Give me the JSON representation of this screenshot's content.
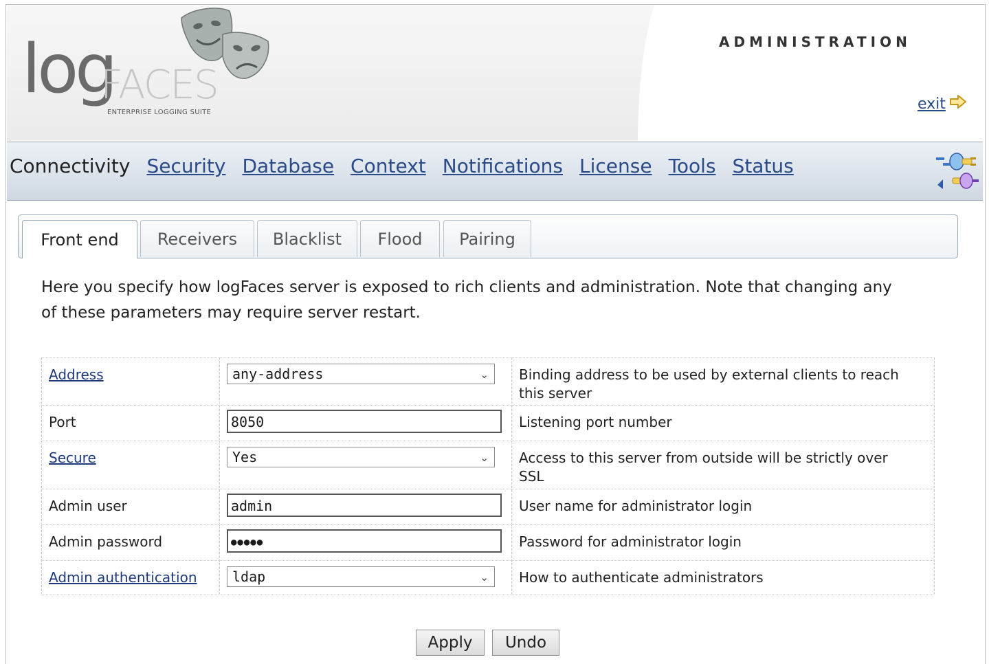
{
  "header": {
    "logo_word": "log",
    "logo_brand": "FACES",
    "logo_tagline": "ENTERPRISE LOGGING SUITE",
    "section_title": "ADMINISTRATION",
    "exit_label": "exit",
    "exit_icon": "arrow-right-outline-icon"
  },
  "nav": {
    "items": [
      {
        "label": "Connectivity",
        "active": true
      },
      {
        "label": "Security",
        "active": false
      },
      {
        "label": "Database",
        "active": false
      },
      {
        "label": "Context",
        "active": false
      },
      {
        "label": "Notifications",
        "active": false
      },
      {
        "label": "License",
        "active": false
      },
      {
        "label": "Tools",
        "active": false
      },
      {
        "label": "Status",
        "active": false
      }
    ],
    "plug_icon": "plug-connection-icon"
  },
  "tabs": [
    {
      "label": "Front end",
      "active": true
    },
    {
      "label": "Receivers",
      "active": false
    },
    {
      "label": "Blacklist",
      "active": false
    },
    {
      "label": "Flood",
      "active": false
    },
    {
      "label": "Pairing",
      "active": false
    }
  ],
  "intro": {
    "line1": "Here you specify how logFaces server is exposed to rich clients and administration. Note that changing any",
    "line2": "of these parameters may require server restart."
  },
  "params": [
    {
      "label": "Address",
      "link": true,
      "control": "select",
      "value": "any-address",
      "desc_line1": "Binding address to be used by external clients to reach",
      "desc_line2": "this server"
    },
    {
      "label": "Port",
      "link": false,
      "control": "text",
      "value": "8050",
      "desc_line1": "Listening port number",
      "desc_line2": ""
    },
    {
      "label": "Secure",
      "link": true,
      "control": "select",
      "value": "Yes",
      "desc_line1": "Access to this server from outside will be strictly over",
      "desc_line2": "SSL"
    },
    {
      "label": "Admin user",
      "link": false,
      "control": "text",
      "value": "admin",
      "desc_line1": "User name for administrator login",
      "desc_line2": ""
    },
    {
      "label": "Admin password",
      "link": false,
      "control": "password",
      "value": "●●●●●",
      "desc_line1": "Password for administrator login",
      "desc_line2": ""
    },
    {
      "label": "Admin authentication",
      "link": true,
      "control": "select",
      "value": "ldap",
      "desc_line1": "How to authenticate administrators",
      "desc_line2": ""
    }
  ],
  "buttons": {
    "apply": "Apply",
    "undo": "Undo"
  },
  "colors": {
    "link": "#2b4a8a",
    "nav_gradient_top": "#ecf1f6",
    "nav_gradient_bottom": "#cfd8e2",
    "header_gray": "#f0f0f0"
  }
}
